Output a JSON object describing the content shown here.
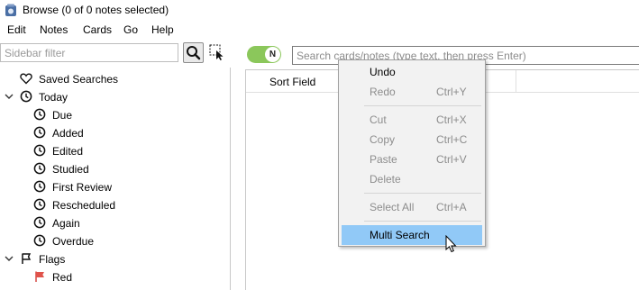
{
  "window": {
    "title": "Browse (0 of 0 notes selected)"
  },
  "menubar": {
    "items": [
      "Edit",
      "Notes",
      "Cards",
      "Go",
      "Help"
    ]
  },
  "sidebar": {
    "filter_placeholder": "Sidebar filter",
    "items": [
      {
        "label": "Saved Searches",
        "icon": "heart-icon",
        "level": 0,
        "expander": false
      },
      {
        "label": "Today",
        "icon": "clock-icon",
        "level": 0,
        "expander": true
      },
      {
        "label": "Due",
        "icon": "clock-icon",
        "level": 1,
        "expander": false
      },
      {
        "label": "Added",
        "icon": "clock-icon",
        "level": 1,
        "expander": false
      },
      {
        "label": "Edited",
        "icon": "clock-icon",
        "level": 1,
        "expander": false
      },
      {
        "label": "Studied",
        "icon": "clock-icon",
        "level": 1,
        "expander": false
      },
      {
        "label": "First Review",
        "icon": "clock-icon",
        "level": 1,
        "expander": false
      },
      {
        "label": "Rescheduled",
        "icon": "clock-icon",
        "level": 1,
        "expander": false
      },
      {
        "label": "Again",
        "icon": "clock-icon",
        "level": 1,
        "expander": false
      },
      {
        "label": "Overdue",
        "icon": "clock-icon",
        "level": 1,
        "expander": false
      },
      {
        "label": "Flags",
        "icon": "flag-icon",
        "level": 0,
        "expander": true
      },
      {
        "label": "Red",
        "icon": "red-flag-icon",
        "level": 1,
        "expander": false
      }
    ]
  },
  "toolbar": {
    "toggle_label": "N",
    "toggle_color": "#8bc75b",
    "search_placeholder": "Search cards/notes (type text, then press Enter)"
  },
  "table": {
    "columns": [
      "Sort Field"
    ]
  },
  "context_menu": {
    "items": [
      {
        "label": "Undo",
        "shortcut": "",
        "enabled": true
      },
      {
        "label": "Redo",
        "shortcut": "Ctrl+Y",
        "enabled": false
      },
      {
        "label": "Cut",
        "shortcut": "Ctrl+X",
        "enabled": false
      },
      {
        "label": "Copy",
        "shortcut": "Ctrl+C",
        "enabled": false
      },
      {
        "label": "Paste",
        "shortcut": "Ctrl+V",
        "enabled": false
      },
      {
        "label": "Delete",
        "shortcut": "",
        "enabled": false
      },
      {
        "label": "Select All",
        "shortcut": "Ctrl+A",
        "enabled": false
      },
      {
        "label": "Multi Search",
        "shortcut": "",
        "enabled": true,
        "highlighted": true
      }
    ],
    "highlight_color": "#91c9f7"
  }
}
